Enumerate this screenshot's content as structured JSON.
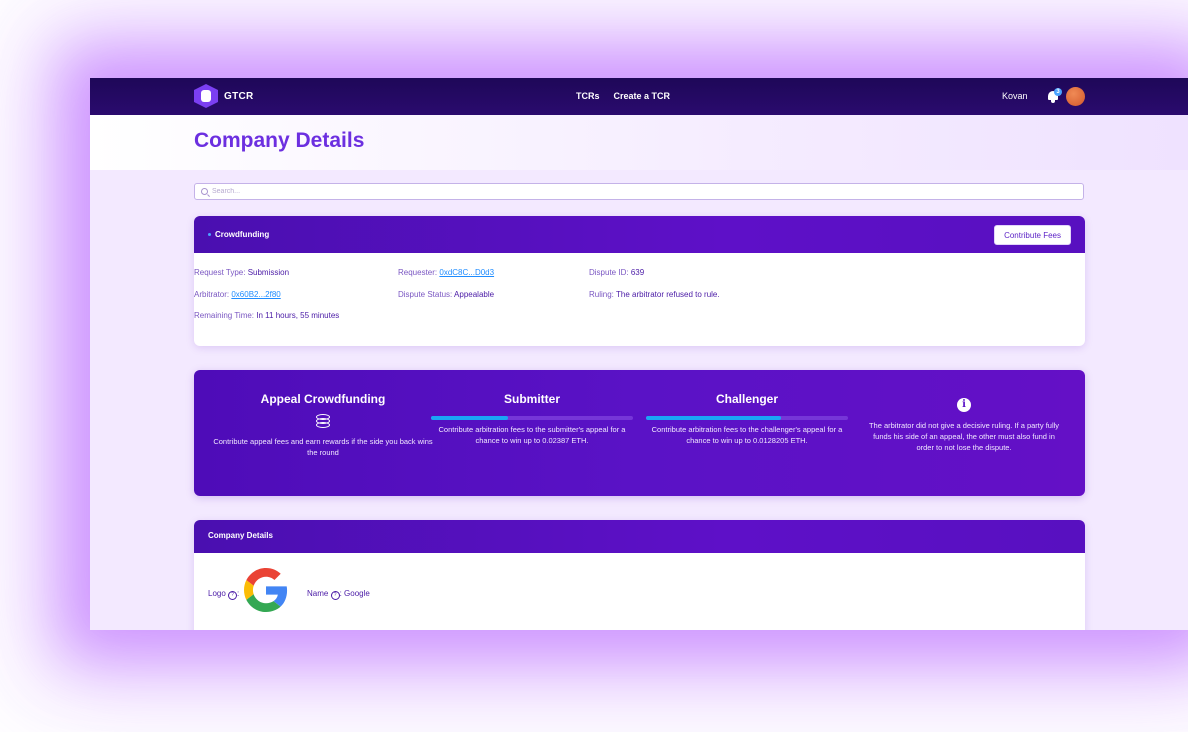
{
  "header": {
    "brand": "GTCR",
    "nav": [
      "TCRs",
      "Create a TCR"
    ],
    "network": "Kovan",
    "notification_count": "3"
  },
  "page": {
    "title": "Company Details"
  },
  "search": {
    "placeholder": "Search..."
  },
  "crowdfunding": {
    "title": "Crowdfunding",
    "button": "Contribute Fees",
    "request_type_label": "Request Type:",
    "request_type": "Submission",
    "requester_label": "Requester:",
    "requester": "0xdC8C...D0d3",
    "dispute_id_label": "Dispute ID:",
    "dispute_id": "639",
    "arbitrator_label": "Arbitrator:",
    "arbitrator": "0x60B2...2f80",
    "dispute_status_label": "Dispute Status:",
    "dispute_status": "Appealable",
    "ruling_label": "Ruling:",
    "ruling": "The arbitrator refused to rule.",
    "remaining_label": "Remaining Time:",
    "remaining": "In 11 hours, 55 minutes"
  },
  "appeal": {
    "title": "Appeal Crowdfunding",
    "icon": "coins-icon",
    "description": "Contribute appeal fees and earn rewards if the side you back wins the round",
    "submitter": {
      "title": "Submitter",
      "progress": 0.38,
      "text": "Contribute arbitration fees to the submitter's appeal for a chance to win up to 0.02387 ETH."
    },
    "challenger": {
      "title": "Challenger",
      "progress": 0.67,
      "text": "Contribute arbitration fees to the challenger's appeal for a chance to win up to 0.0128205 ETH."
    },
    "info_icon": "info-icon",
    "info": "The arbitrator did not give a decisive ruling. If a party fully funds his side of an appeal, the other must also fund in order to not lose the dispute."
  },
  "details": {
    "title": "Company Details",
    "logo_label": "Logo",
    "name_label": "Name",
    "name": "Google"
  },
  "colors": {
    "accent": "#6c2fe0",
    "header": "#2a0a6e",
    "progress": "#1aa6f5"
  }
}
